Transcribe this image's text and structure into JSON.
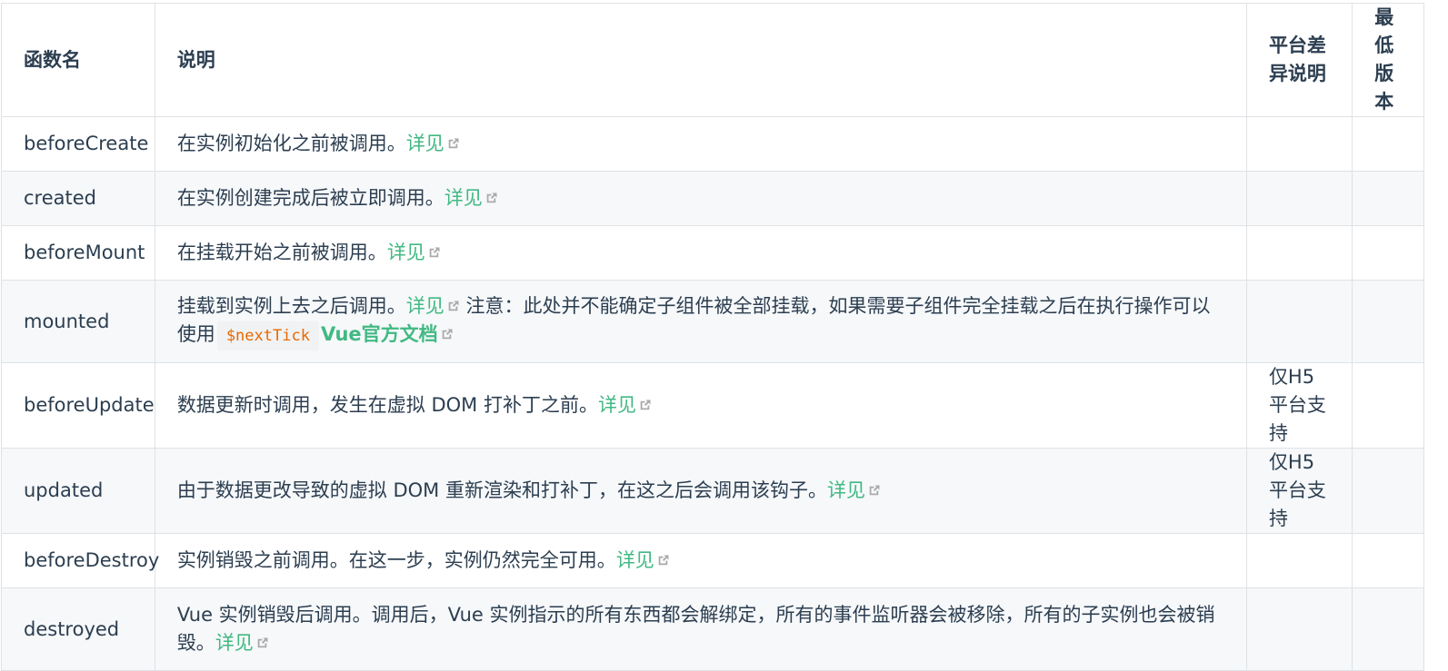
{
  "colors": {
    "link": "#42b983",
    "code_text": "#e96900",
    "border": "#dfe2e5",
    "stripe": "#f6f8fa"
  },
  "headers": {
    "name": "函数名",
    "desc": "说明",
    "platform": "平台差异说明",
    "version": "最低版本"
  },
  "rows": [
    {
      "name": "beforeCreate",
      "desc": "在实例初始化之前被调用。",
      "link": "详见",
      "platform": "",
      "version": ""
    },
    {
      "name": "created",
      "desc": "在实例创建完成后被立即调用。",
      "link": "详见",
      "platform": "",
      "version": ""
    },
    {
      "name": "beforeMount",
      "desc": "在挂载开始之前被调用。",
      "link": "详见",
      "platform": "",
      "version": ""
    },
    {
      "name": "mounted",
      "desc": "挂载到实例上去之后调用。",
      "link": "详见",
      "note": "注意：此处并不能确定子组件被全部挂载，如果需要子组件完全挂载之后在执行操作可以使用",
      "code": "$nextTick",
      "link2": "Vue官方文档",
      "platform": "",
      "version": ""
    },
    {
      "name": "beforeUpdate",
      "desc": "数据更新时调用，发生在虚拟 DOM 打补丁之前。",
      "link": "详见",
      "platform": "仅H5平台支持",
      "version": ""
    },
    {
      "name": "updated",
      "desc": "由于数据更改导致的虚拟 DOM 重新渲染和打补丁，在这之后会调用该钩子。",
      "link": "详见",
      "platform": "仅H5平台支持",
      "version": ""
    },
    {
      "name": "beforeDestroy",
      "desc": "实例销毁之前调用。在这一步，实例仍然完全可用。",
      "link": "详见",
      "platform": "",
      "version": ""
    },
    {
      "name": "destroyed",
      "desc": "Vue 实例销毁后调用。调用后，Vue 实例指示的所有东西都会解绑定，所有的事件监听器会被移除，所有的子实例也会被销毁。",
      "link": "详见",
      "platform": "",
      "version": ""
    }
  ]
}
